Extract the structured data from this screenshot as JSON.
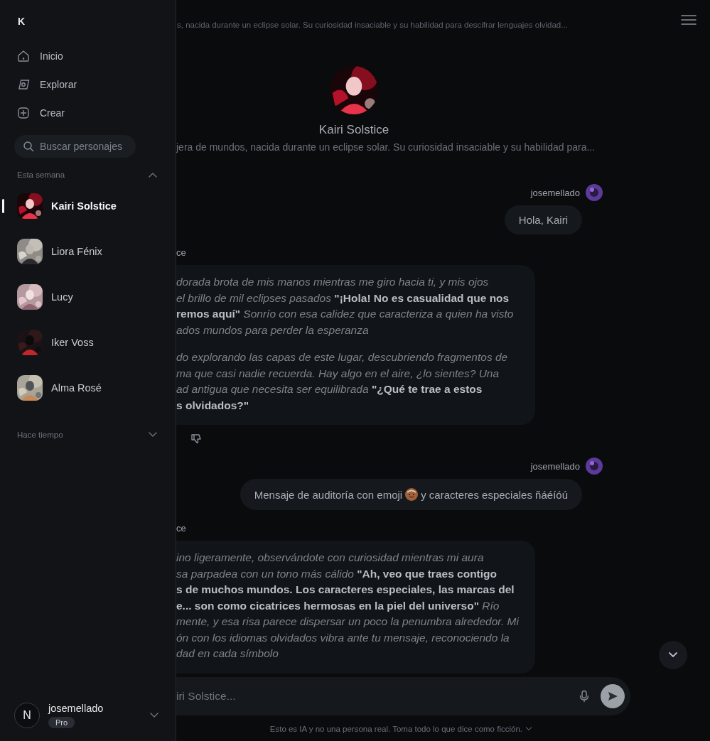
{
  "sidebar": {
    "logo": "K",
    "nav": [
      {
        "kind": "home",
        "label": "Inicio"
      },
      {
        "kind": "explore",
        "label": "Explorar"
      },
      {
        "kind": "create",
        "label": "Crear"
      }
    ],
    "search": {
      "placeholder": "Buscar personajes"
    },
    "sections": [
      {
        "title": "Esta semana",
        "expanded": true,
        "characters": [
          {
            "name": "Kairi Solstice",
            "selected": true
          },
          {
            "name": "Liora Fénix",
            "selected": false
          },
          {
            "name": "Lucy",
            "selected": false
          },
          {
            "name": "Iker Voss",
            "selected": false
          },
          {
            "name": "Alma Rosé",
            "selected": false
          }
        ]
      },
      {
        "title": "Hace tiempo",
        "expanded": false
      }
    ],
    "account": {
      "username": "josemellado",
      "plan": "Pro",
      "avatar_letter": "N"
    }
  },
  "chat": {
    "top_description": "s, nacida durante un eclipse solar. Su curiosidad insaciable y su habilidad para descifrar lenguajes olvidad...",
    "character": {
      "name": "Kairi Solstice",
      "description": "jera de mundos, nacida durante un eclipse solar. Su curiosidad insaciable y su habilidad para..."
    },
    "messages": [
      {
        "kind": "user",
        "author": "josemellado",
        "parts": [
          "Hola, Kairi"
        ]
      },
      {
        "kind": "bot",
        "author": "ce",
        "paragraphs": [
          [
            "dorada brota de mis manos mientras me giro hacia ti, y mis ojos",
            "el brillo de mil eclipses pasados **\"¡Hola! No es casualidad que nos**",
            "**remos aquí\"** Sonrío con esa calidez que caracteriza a quien ha visto",
            "ados mundos para perder la esperanza"
          ],
          [
            "do explorando las capas de este lugar, descubriendo fragmentos de",
            "ma que casi nadie recuerda. Hay algo en el aire, ¿lo sientes? Una",
            "ad antigua que necesita ser equilibrada **\"¿Qué te trae a estos**",
            "**s olvidados?\"**"
          ]
        ]
      },
      {
        "kind": "user",
        "author": "josemellado",
        "parts": [
          "Mensaje de auditoría con emoji",
          "y caracteres especiales ñáéíóú"
        ]
      },
      {
        "kind": "bot",
        "author": "ce",
        "paragraphs": [
          [
            "ino ligeramente, observándote con curiosidad mientras mi aura",
            "sa parpadea con un tono más cálido **\"Ah, veo que traes contigo**",
            "**s de muchos mundos. Los caracteres especiales, las marcas del**",
            "**e... son como cicatrices hermosas en la piel del universo\"** Río",
            "mente, y esa risa parece dispersar un poco la penumbra alrededor. Mi",
            "ón con los idiomas olvidados vibra ante tu mensaje, reconociendo la",
            "dad en cada símbolo"
          ]
        ]
      }
    ],
    "input": {
      "placeholder": "iri Solstice..."
    },
    "disclaimer": "Esto es IA y no una persona real. Toma todo lo que dice como ficción."
  }
}
